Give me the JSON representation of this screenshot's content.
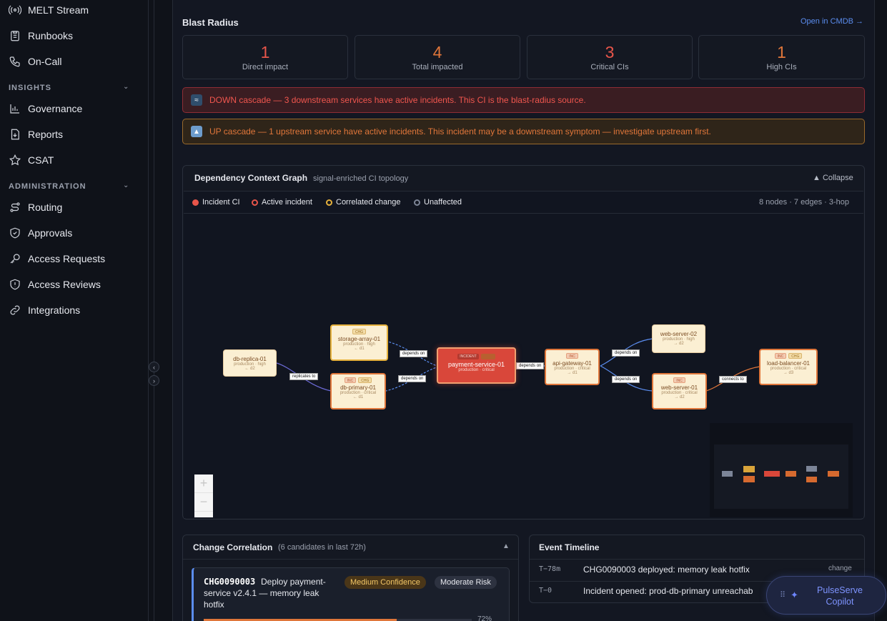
{
  "sidebar": {
    "items_top": [
      {
        "label": "MELT Stream",
        "icon": "radio-signal-icon"
      },
      {
        "label": "Runbooks",
        "icon": "clipboard-icon"
      },
      {
        "label": "On-Call",
        "icon": "phone-icon"
      }
    ],
    "insights_label": "INSIGHTS",
    "insights_items": [
      {
        "label": "Governance",
        "icon": "chart-icon"
      },
      {
        "label": "Reports",
        "icon": "file-download-icon"
      },
      {
        "label": "CSAT",
        "icon": "star-icon"
      }
    ],
    "admin_label": "ADMINISTRATION",
    "admin_items": [
      {
        "label": "Routing",
        "icon": "route-icon"
      },
      {
        "label": "Approvals",
        "icon": "shield-check-icon"
      },
      {
        "label": "Access Requests",
        "icon": "key-icon"
      },
      {
        "label": "Access Reviews",
        "icon": "shield-alert-icon"
      },
      {
        "label": "Integrations",
        "icon": "link-icon"
      }
    ]
  },
  "blast": {
    "title": "Blast Radius",
    "cmdb_link": "Open in CMDB →",
    "stats": [
      {
        "value": "1",
        "label": "Direct impact",
        "color": "#e8554a"
      },
      {
        "value": "4",
        "label": "Total impacted",
        "color": "#e0763a"
      },
      {
        "value": "3",
        "label": "Critical CIs",
        "color": "#e8554a"
      },
      {
        "value": "1",
        "label": "High CIs",
        "color": "#e0763a"
      }
    ],
    "down_banner": "DOWN cascade — 3 downstream services have active incidents. This CI is the blast-radius source.",
    "up_banner": "UP cascade — 1 upstream service have active incidents. This incident may be a downstream symptom — investigate upstream first."
  },
  "graph": {
    "title": "Dependency Context Graph",
    "subtitle": "signal-enriched CI topology",
    "collapse_label": "▲ Collapse",
    "legend": [
      "Incident CI",
      "Active incident",
      "Correlated change",
      "Unaffected"
    ],
    "stats": "8 nodes · 7 edges · 3-hop",
    "nodes": {
      "db_replica": {
        "name": "db-replica-01",
        "sub": "production · high",
        "hop": "← d2"
      },
      "storage_array": {
        "name": "storage-array-01",
        "sub": "production · high",
        "hop": "← d1",
        "badge": "CHG"
      },
      "db_primary": {
        "name": "db-primary-01",
        "sub": "production · critical",
        "hop": "← d1",
        "badge1": "INC",
        "badge2": "CHG"
      },
      "payment": {
        "name": "payment-service-01",
        "sub": "production · critical",
        "badge": "INCIDENT"
      },
      "api_gateway": {
        "name": "api-gateway-01",
        "sub": "production · critical",
        "hop": "→ d1",
        "badge": "INC"
      },
      "web_server_02": {
        "name": "web-server-02",
        "sub": "production · high",
        "hop": "→ d2"
      },
      "web_server_01": {
        "name": "web-server-01",
        "sub": "production · critical",
        "hop": "→ d2",
        "badge": "INC"
      },
      "load_balancer": {
        "name": "load-balancer-01",
        "sub": "production · critical",
        "hop": "→ d3",
        "badge1": "INC",
        "badge2": "CHG"
      }
    },
    "edges": {
      "replicates": "replicates to",
      "depends1": "depends on",
      "depends2": "depends on",
      "depends3": "depends on",
      "depends4": "depends on",
      "depends5": "depends on",
      "connects": "connects to"
    },
    "zoom_in": "+",
    "zoom_out": "−"
  },
  "change_correlation": {
    "title": "Change Correlation",
    "subtitle": "(6 candidates in last 72h)",
    "caret": "▲",
    "item": {
      "id": "CHG0090003",
      "desc": "Deploy payment-service v2.4.1 — memory leak hotfix",
      "confidence": "Medium Confidence",
      "risk": "Moderate Risk",
      "percent": "72%",
      "percent_value": 72
    }
  },
  "timeline": {
    "title": "Event Timeline",
    "events": [
      {
        "time": "T−78m",
        "text": "CHG0090003 deployed: memory leak hotfix",
        "kind": "change"
      },
      {
        "time": "T−0",
        "text": "Incident opened: prod-db-primary unreachab"
      }
    ]
  },
  "copilot": {
    "label": "PulseServe Copilot"
  },
  "colors": {
    "accent": "#5b8def",
    "incident": "#d9473a",
    "change": "#e0763a"
  }
}
